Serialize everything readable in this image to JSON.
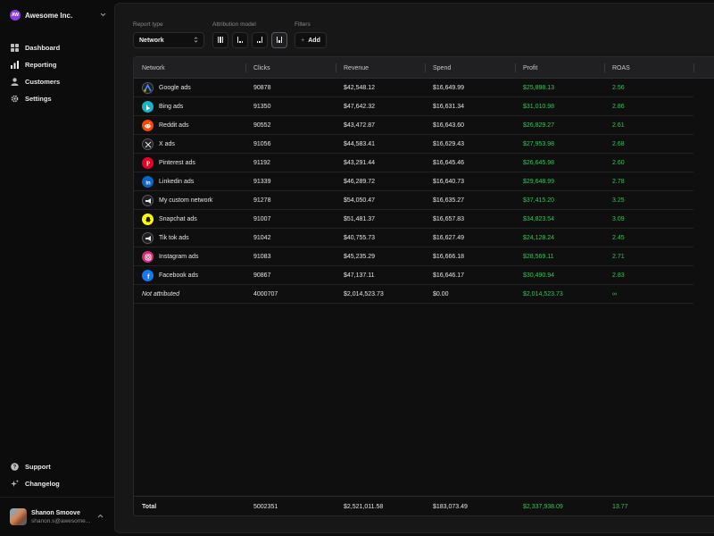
{
  "org": {
    "initials": "AW",
    "name": "Awesome Inc."
  },
  "nav": {
    "main": [
      {
        "label": "Dashboard",
        "icon": "dashboard-icon"
      },
      {
        "label": "Reporting",
        "icon": "bar-chart-icon"
      },
      {
        "label": "Customers",
        "icon": "user-icon"
      },
      {
        "label": "Settings",
        "icon": "gear-icon"
      }
    ],
    "bottom": [
      {
        "label": "Support",
        "icon": "help-icon"
      },
      {
        "label": "Changelog",
        "icon": "sparkle-icon"
      }
    ]
  },
  "user": {
    "name": "Shanon Smoove",
    "email": "shanon.s@awesome..."
  },
  "controls": {
    "report_type_label": "Report type",
    "report_type_value": "Network",
    "attribution_label": "Attribution model",
    "filters_label": "Filters",
    "add_label": "Add"
  },
  "table": {
    "columns": [
      "Network",
      "Clicks",
      "Revenue",
      "Spend",
      "Profit",
      "ROAS"
    ],
    "rows": [
      {
        "network": "Google ads",
        "icon": "google-ads-icon",
        "icon_color": "#1f1f22",
        "clicks": "90878",
        "revenue": "$42,548.12",
        "spend": "$16,649.99",
        "profit": "$25,898.13",
        "roas": "2.56"
      },
      {
        "network": "Bing ads",
        "icon": "bing-icon",
        "icon_color": "#19b4c4",
        "clicks": "91350",
        "revenue": "$47,642.32",
        "spend": "$16,631.34",
        "profit": "$31,010.98",
        "roas": "2.86"
      },
      {
        "network": "Reddit ads",
        "icon": "reddit-icon",
        "icon_color": "#ff4500",
        "clicks": "90552",
        "revenue": "$43,472.87",
        "spend": "$16,643.60",
        "profit": "$26,829.27",
        "roas": "2.61"
      },
      {
        "network": "X ads",
        "icon": "x-icon",
        "icon_color": "#1f1f22",
        "clicks": "91056",
        "revenue": "$44,583.41",
        "spend": "$16,629.43",
        "profit": "$27,953.98",
        "roas": "2.68"
      },
      {
        "network": "Pinterest ads",
        "icon": "pinterest-icon",
        "icon_color": "#e60023",
        "clicks": "91192",
        "revenue": "$43,291.44",
        "spend": "$16,645.46",
        "profit": "$26,645.98",
        "roas": "2.60"
      },
      {
        "network": "Linkedin ads",
        "icon": "linkedin-icon",
        "icon_color": "#0a66c2",
        "clicks": "91339",
        "revenue": "$46,289.72",
        "spend": "$16,640.73",
        "profit": "$29,648.99",
        "roas": "2.78"
      },
      {
        "network": "My custom network",
        "icon": "megaphone-icon",
        "icon_color": "#1f1f22",
        "clicks": "91278",
        "revenue": "$54,050.47",
        "spend": "$16,635.27",
        "profit": "$37,415.20",
        "roas": "3.25"
      },
      {
        "network": "Snapchat ads",
        "icon": "snapchat-icon",
        "icon_color": "#fffc00",
        "clicks": "91007",
        "revenue": "$51,481.37",
        "spend": "$16,657.83",
        "profit": "$34,823.54",
        "roas": "3.09"
      },
      {
        "network": "Tik tok ads",
        "icon": "megaphone-icon",
        "icon_color": "#1f1f22",
        "clicks": "91042",
        "revenue": "$40,755.73",
        "spend": "$16,627.49",
        "profit": "$24,128.24",
        "roas": "2.45"
      },
      {
        "network": "Instagram ads",
        "icon": "instagram-icon",
        "icon_color": "#d62976",
        "clicks": "91083",
        "revenue": "$45,235.29",
        "spend": "$16,666.18",
        "profit": "$28,569.11",
        "roas": "2.71"
      },
      {
        "network": "Facebook ads",
        "icon": "facebook-icon",
        "icon_color": "#1877f2",
        "clicks": "90867",
        "revenue": "$47,137.11",
        "spend": "$16,646.17",
        "profit": "$30,490.94",
        "roas": "2.83"
      }
    ],
    "not_attributed": {
      "network": "Not attributed",
      "clicks": "4000707",
      "revenue": "$2,014,523.73",
      "spend": "$0.00",
      "profit": "$2,014,523.73",
      "roas": "∞"
    },
    "total": {
      "label": "Total",
      "clicks": "5002351",
      "revenue": "$2,521,011.58",
      "spend": "$183,073.49",
      "profit": "$2,337,938.09",
      "roas": "13.77"
    }
  },
  "colors": {
    "accent_purple": "#8b3fe0",
    "profit_green": "#3fbf5f",
    "panel": "#171718",
    "background": "#0c0c0d"
  }
}
